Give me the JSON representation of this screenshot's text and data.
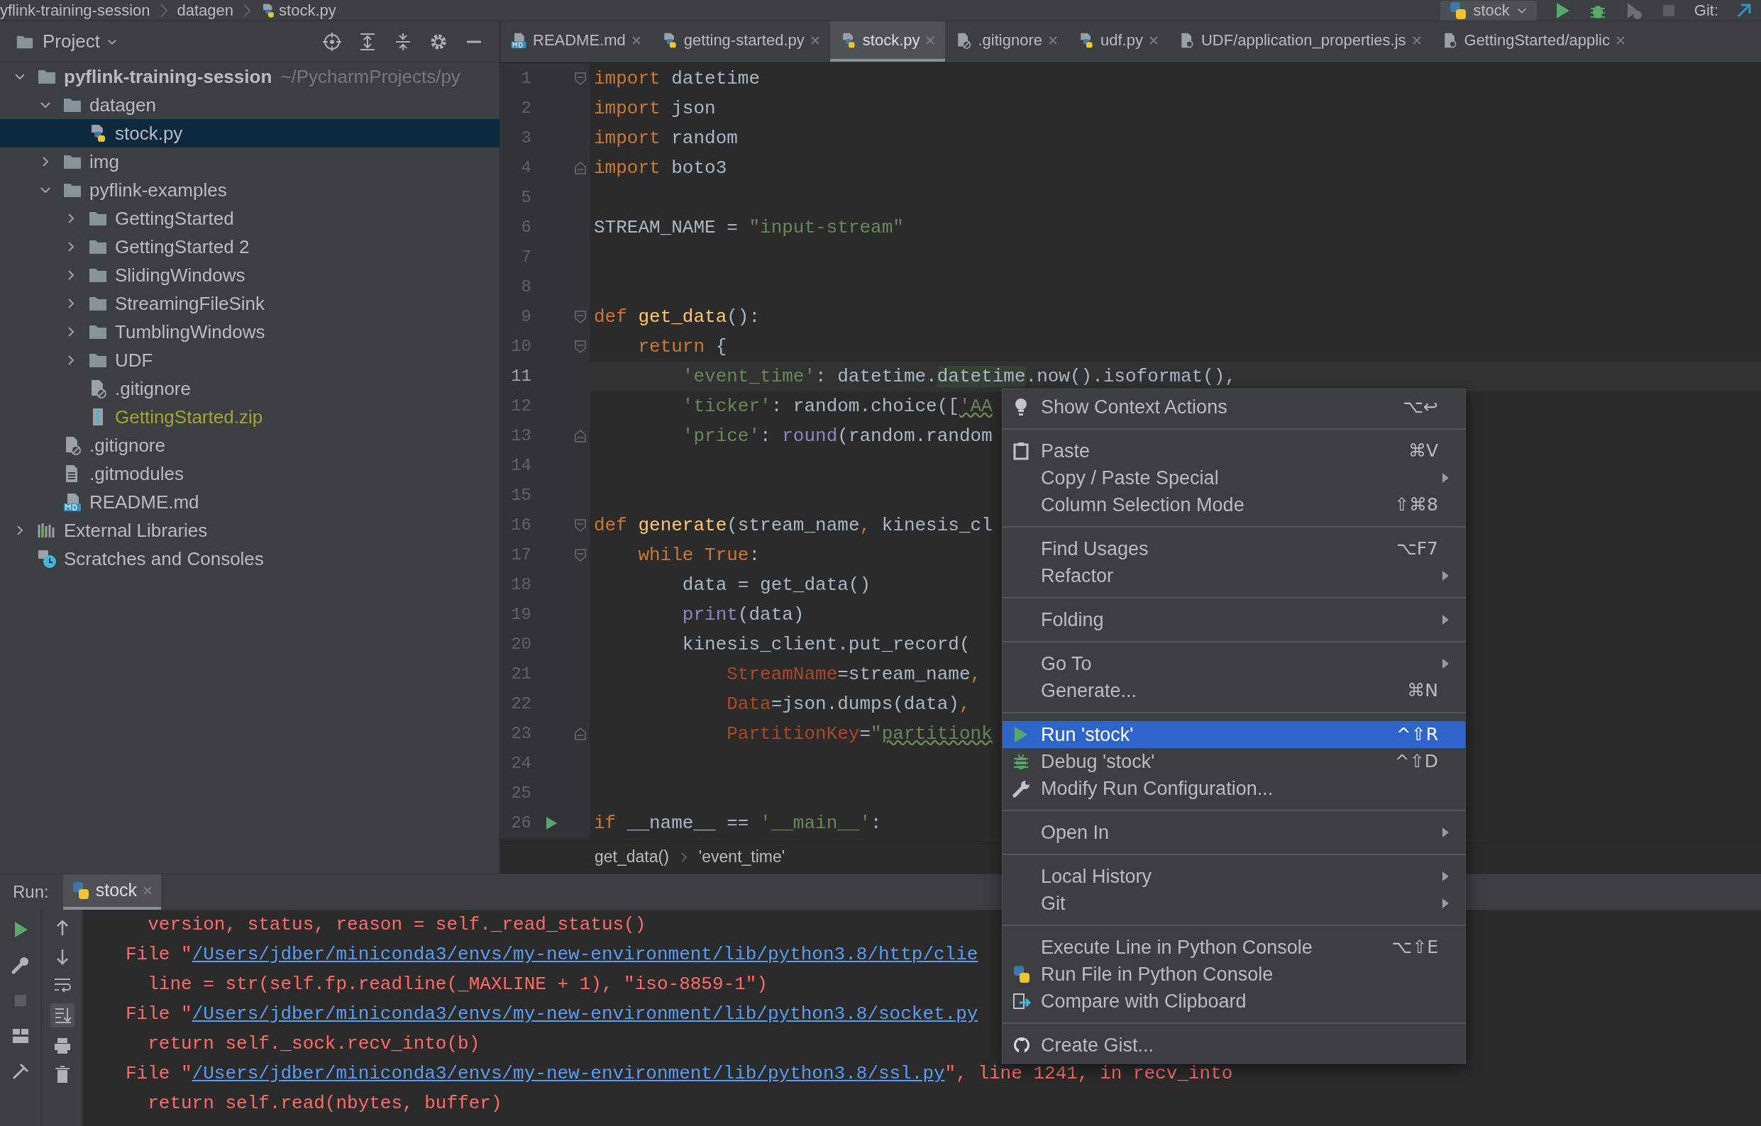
{
  "breadcrumbs": [
    "yflink-training-session",
    "datagen",
    "stock.py"
  ],
  "toolbar": {
    "run_config": "stock",
    "vcs_label": "Git:"
  },
  "project_panel": {
    "title": "Project",
    "tree": [
      {
        "name": "pyflink-training-session",
        "kind": "folder",
        "expanded": true,
        "selected": false,
        "suffix": "~/PycharmProjects/py",
        "children": [
          {
            "name": "datagen",
            "kind": "folder",
            "expanded": true,
            "selected": false,
            "children": [
              {
                "name": "stock.py",
                "kind": "python",
                "selected": true
              }
            ]
          },
          {
            "name": "img",
            "kind": "folder",
            "expanded": false,
            "selected": false
          },
          {
            "name": "pyflink-examples",
            "kind": "folder",
            "expanded": true,
            "selected": false,
            "children": [
              {
                "name": "GettingStarted",
                "kind": "folder",
                "expanded": false,
                "selected": false
              },
              {
                "name": "GettingStarted 2",
                "kind": "folder",
                "expanded": false,
                "selected": false
              },
              {
                "name": "SlidingWindows",
                "kind": "folder",
                "expanded": false,
                "selected": false
              },
              {
                "name": "StreamingFileSink",
                "kind": "folder",
                "expanded": false,
                "selected": false
              },
              {
                "name": "TumblingWindows",
                "kind": "folder",
                "expanded": false,
                "selected": false
              },
              {
                "name": "UDF",
                "kind": "folder",
                "expanded": false,
                "selected": false
              },
              {
                "name": ".gitignore",
                "kind": "gitignore",
                "selected": false
              },
              {
                "name": "GettingStarted.zip",
                "kind": "zip",
                "selected": false,
                "color": "#a8a22e"
              }
            ]
          },
          {
            "name": ".gitignore",
            "kind": "gitignore",
            "selected": false
          },
          {
            "name": ".gitmodules",
            "kind": "text",
            "selected": false
          },
          {
            "name": "README.md",
            "kind": "markdown",
            "selected": false
          }
        ]
      },
      {
        "name": "External Libraries",
        "kind": "libraries",
        "expanded": false,
        "selected": false
      },
      {
        "name": "Scratches and Consoles",
        "kind": "scratches",
        "selected": false
      }
    ]
  },
  "editor_tabs": [
    {
      "label": "README.md",
      "kind": "markdown",
      "selected": false
    },
    {
      "label": "getting-started.py",
      "kind": "python",
      "selected": false
    },
    {
      "label": "stock.py",
      "kind": "python",
      "selected": true
    },
    {
      "label": ".gitignore",
      "kind": "gitignore",
      "selected": false
    },
    {
      "label": "udf.py",
      "kind": "python",
      "selected": false
    },
    {
      "label": "UDF/application_properties.js",
      "kind": "file",
      "selected": false
    },
    {
      "label": "GettingStarted/applic",
      "kind": "file",
      "selected": false
    }
  ],
  "code_lines": [
    {
      "number": "1",
      "current": false,
      "kind": "fold_start",
      "tokens": [
        {
          "kind": "kw",
          "text": "import "
        },
        {
          "kind": "plain",
          "text": "datetime"
        }
      ]
    },
    {
      "number": "2",
      "current": false,
      "kind": "plain",
      "tokens": [
        {
          "kind": "kw",
          "text": "import "
        },
        {
          "kind": "plain",
          "text": "json"
        }
      ]
    },
    {
      "number": "3",
      "current": false,
      "kind": "plain",
      "tokens": [
        {
          "kind": "kw",
          "text": "import "
        },
        {
          "kind": "plain",
          "text": "random"
        }
      ]
    },
    {
      "number": "4",
      "current": false,
      "kind": "fold_end",
      "tokens": [
        {
          "kind": "kw",
          "text": "import "
        },
        {
          "kind": "plain",
          "text": "boto3"
        }
      ]
    },
    {
      "number": "5",
      "current": false,
      "kind": "plain"
    },
    {
      "number": "6",
      "current": false,
      "kind": "plain",
      "tokens": [
        {
          "kind": "plain",
          "text": "STREAM_NAME = "
        },
        {
          "kind": "str",
          "text": "\"input-stream\""
        }
      ]
    },
    {
      "number": "7",
      "current": false,
      "kind": "plain"
    },
    {
      "number": "8",
      "current": false,
      "kind": "plain"
    },
    {
      "number": "9",
      "current": false,
      "kind": "fold_start",
      "tokens": [
        {
          "kind": "kw",
          "text": "def "
        },
        {
          "kind": "fn",
          "text": "get_data"
        },
        {
          "kind": "plain",
          "text": "():"
        }
      ]
    },
    {
      "number": "10",
      "current": false,
      "kind": "fold_start",
      "tokens": [
        {
          "kind": "kw",
          "text": "    return "
        },
        {
          "kind": "plain",
          "text": "{"
        }
      ]
    },
    {
      "number": "11",
      "current": true,
      "kind": "plain",
      "tokens": [
        {
          "kind": "str",
          "text": "        'event_time'"
        },
        {
          "kind": "plain",
          "text": ": datetime."
        },
        {
          "kind": "hl",
          "text": "datetime"
        },
        {
          "kind": "plain",
          "text": ".now().isoformat(),"
        }
      ]
    },
    {
      "number": "12",
      "current": false,
      "kind": "plain",
      "tokens": [
        {
          "kind": "str",
          "text": "        'ticker'"
        },
        {
          "kind": "plain",
          "text": ": random.choice(["
        },
        {
          "kind": "typo",
          "text": "'AA"
        }
      ]
    },
    {
      "number": "13",
      "current": false,
      "kind": "fold_end",
      "tokens": [
        {
          "kind": "str",
          "text": "        'price'"
        },
        {
          "kind": "plain",
          "text": ": "
        },
        {
          "kind": "builtin",
          "text": "round"
        },
        {
          "kind": "plain",
          "text": "(random.random"
        }
      ]
    },
    {
      "number": "14",
      "current": false,
      "kind": "plain"
    },
    {
      "number": "15",
      "current": false,
      "kind": "plain"
    },
    {
      "number": "16",
      "current": false,
      "kind": "fold_start",
      "tokens": [
        {
          "kind": "kw",
          "text": "def "
        },
        {
          "kind": "fn",
          "text": "generate"
        },
        {
          "kind": "plain",
          "text": "(stream_name"
        },
        {
          "kind": "kw",
          "text": ", "
        },
        {
          "kind": "plain",
          "text": "kinesis_cl"
        }
      ]
    },
    {
      "number": "17",
      "current": false,
      "kind": "fold_start",
      "tokens": [
        {
          "kind": "kw",
          "text": "    while True"
        },
        {
          "kind": "plain",
          "text": ":"
        }
      ]
    },
    {
      "number": "18",
      "current": false,
      "kind": "plain",
      "tokens": [
        {
          "kind": "plain",
          "text": "        data = get_data()"
        }
      ]
    },
    {
      "number": "19",
      "current": false,
      "kind": "plain",
      "tokens": [
        {
          "kind": "builtin",
          "text": "        print"
        },
        {
          "kind": "plain",
          "text": "(data)"
        }
      ]
    },
    {
      "number": "20",
      "current": false,
      "kind": "plain",
      "tokens": [
        {
          "kind": "plain",
          "text": "        kinesis_client.put_record("
        }
      ]
    },
    {
      "number": "21",
      "current": false,
      "kind": "plain",
      "tokens": [
        {
          "kind": "param",
          "text": "            StreamName"
        },
        {
          "kind": "plain",
          "text": "=stream_name"
        },
        {
          "kind": "kw",
          "text": ","
        }
      ]
    },
    {
      "number": "22",
      "current": false,
      "kind": "plain",
      "tokens": [
        {
          "kind": "param",
          "text": "            Data"
        },
        {
          "kind": "plain",
          "text": "=json.dumps(data)"
        },
        {
          "kind": "kw",
          "text": ","
        }
      ]
    },
    {
      "number": "23",
      "current": false,
      "kind": "fold_end",
      "tokens": [
        {
          "kind": "param",
          "text": "            PartitionKey"
        },
        {
          "kind": "plain",
          "text": "="
        },
        {
          "kind": "str",
          "text": "\""
        },
        {
          "kind": "typo",
          "text": "partitionk"
        }
      ]
    },
    {
      "number": "24",
      "current": false,
      "kind": "plain"
    },
    {
      "number": "25",
      "current": false,
      "kind": "plain"
    },
    {
      "number": "26",
      "current": false,
      "kind": "run",
      "tokens": [
        {
          "kind": "kw",
          "text": "if "
        },
        {
          "kind": "plain",
          "text": "__name__ == "
        },
        {
          "kind": "str",
          "text": "'__main__'"
        },
        {
          "kind": "plain",
          "text": ":"
        }
      ]
    }
  ],
  "editor_breadcrumb": [
    "get_data()",
    "'event_time'"
  ],
  "context_menu": {
    "sections": [
      [
        {
          "label": "Show Context Actions",
          "kind": "bulb",
          "shortcut": "⌥↩",
          "submenu": false,
          "selected": false
        }
      ],
      [
        {
          "label": "Paste",
          "kind": "paste",
          "shortcut": "⌘V",
          "submenu": false,
          "selected": false
        },
        {
          "label": "Copy / Paste Special",
          "kind": "plain",
          "submenu": true,
          "selected": false
        },
        {
          "label": "Column Selection Mode",
          "kind": "plain",
          "shortcut": "⇧⌘8",
          "submenu": false,
          "selected": false
        }
      ],
      [
        {
          "label": "Find Usages",
          "kind": "plain",
          "shortcut": "⌥F7",
          "submenu": false,
          "selected": false
        },
        {
          "label": "Refactor",
          "kind": "plain",
          "submenu": true,
          "selected": false
        }
      ],
      [
        {
          "label": "Folding",
          "kind": "plain",
          "submenu": true,
          "selected": false
        }
      ],
      [
        {
          "label": "Go To",
          "kind": "plain",
          "submenu": true,
          "selected": false
        },
        {
          "label": "Generate...",
          "kind": "plain",
          "shortcut": "⌘N",
          "submenu": false,
          "selected": false
        }
      ],
      [
        {
          "label": "Run 'stock'",
          "kind": "run",
          "shortcut": "^⇧R",
          "submenu": false,
          "selected": true
        },
        {
          "label": "Debug 'stock'",
          "kind": "debug",
          "shortcut": "^⇧D",
          "submenu": false,
          "selected": false
        },
        {
          "label": "Modify Run Configuration...",
          "kind": "wrench",
          "submenu": false,
          "selected": false
        }
      ],
      [
        {
          "label": "Open In",
          "kind": "plain",
          "submenu": true,
          "selected": false
        }
      ],
      [
        {
          "label": "Local History",
          "kind": "plain",
          "submenu": true,
          "selected": false
        },
        {
          "label": "Git",
          "kind": "plain",
          "submenu": true,
          "selected": false
        }
      ],
      [
        {
          "label": "Execute Line in Python Console",
          "kind": "plain",
          "shortcut": "⌥⇧E",
          "submenu": false,
          "selected": false
        },
        {
          "label": "Run File in Python Console",
          "kind": "python",
          "submenu": false,
          "selected": false
        },
        {
          "label": "Compare with Clipboard",
          "kind": "compare",
          "submenu": false,
          "selected": false
        }
      ],
      [
        {
          "label": "Create Gist...",
          "kind": "github",
          "submenu": false,
          "selected": false
        }
      ]
    ]
  },
  "run_panel": {
    "label": "Run:",
    "tabs": [
      {
        "label": "stock",
        "selected": true
      }
    ],
    "console": [
      {
        "kind": "code",
        "text": "  version, status, reason = self._read_status()"
      },
      {
        "kind": "file",
        "prefix": "File \"",
        "path": "/Users/jdber/miniconda3/envs/my-new-environment/lib/python3.8/http/clie"
      },
      {
        "kind": "code",
        "text": "  line = str(self.fp.readline(_MAXLINE + 1), \"iso-8859-1\")"
      },
      {
        "kind": "file",
        "prefix": "File \"",
        "path": "/Users/jdber/miniconda3/envs/my-new-environment/lib/python3.8/socket.py"
      },
      {
        "kind": "code",
        "text": "  return self._sock.recv_into(b)"
      },
      {
        "kind": "file",
        "prefix": "File \"",
        "path": "/Users/jdber/miniconda3/envs/my-new-environment/lib/python3.8/ssl.py",
        "suffix": "\", line 1241, in recv_into"
      },
      {
        "kind": "code",
        "text": "  return self.read(nbytes, buffer)"
      }
    ]
  }
}
